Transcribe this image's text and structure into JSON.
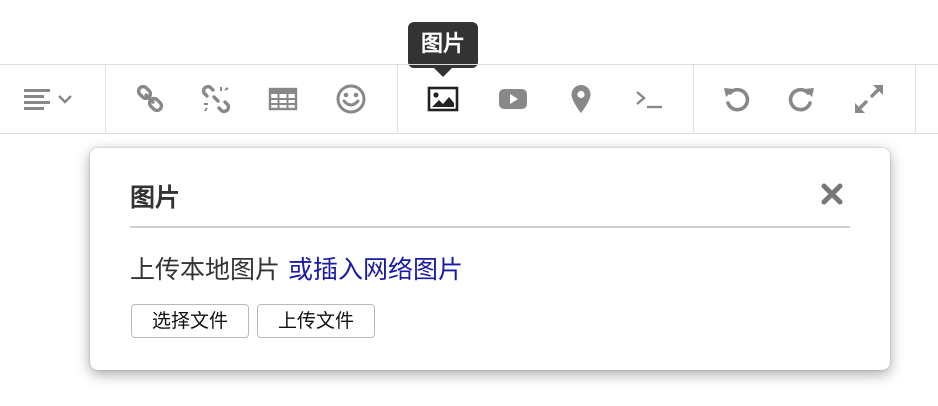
{
  "tooltip": {
    "text": "图片"
  },
  "toolbar": {
    "buttons": [
      {
        "icon": "align-dropdown-icon"
      },
      {
        "icon": "link-icon"
      },
      {
        "icon": "unlink-icon"
      },
      {
        "icon": "table-icon"
      },
      {
        "icon": "emoji-icon"
      },
      {
        "icon": "image-icon",
        "active": true
      },
      {
        "icon": "video-icon"
      },
      {
        "icon": "location-icon"
      },
      {
        "icon": "code-terminal-icon"
      },
      {
        "icon": "undo-icon"
      },
      {
        "icon": "redo-icon"
      },
      {
        "icon": "fullscreen-icon"
      }
    ]
  },
  "dialog": {
    "title": "图片",
    "upload_local": "上传本地图片",
    "insert_network_link": "或插入网络图片",
    "choose_file_label": "选择文件",
    "upload_file_label": "上传文件"
  },
  "colors": {
    "tooltip_bg": "#333333",
    "icon_gray": "#888888",
    "icon_active": "#222222",
    "link_blue": "#1a1aa6"
  }
}
